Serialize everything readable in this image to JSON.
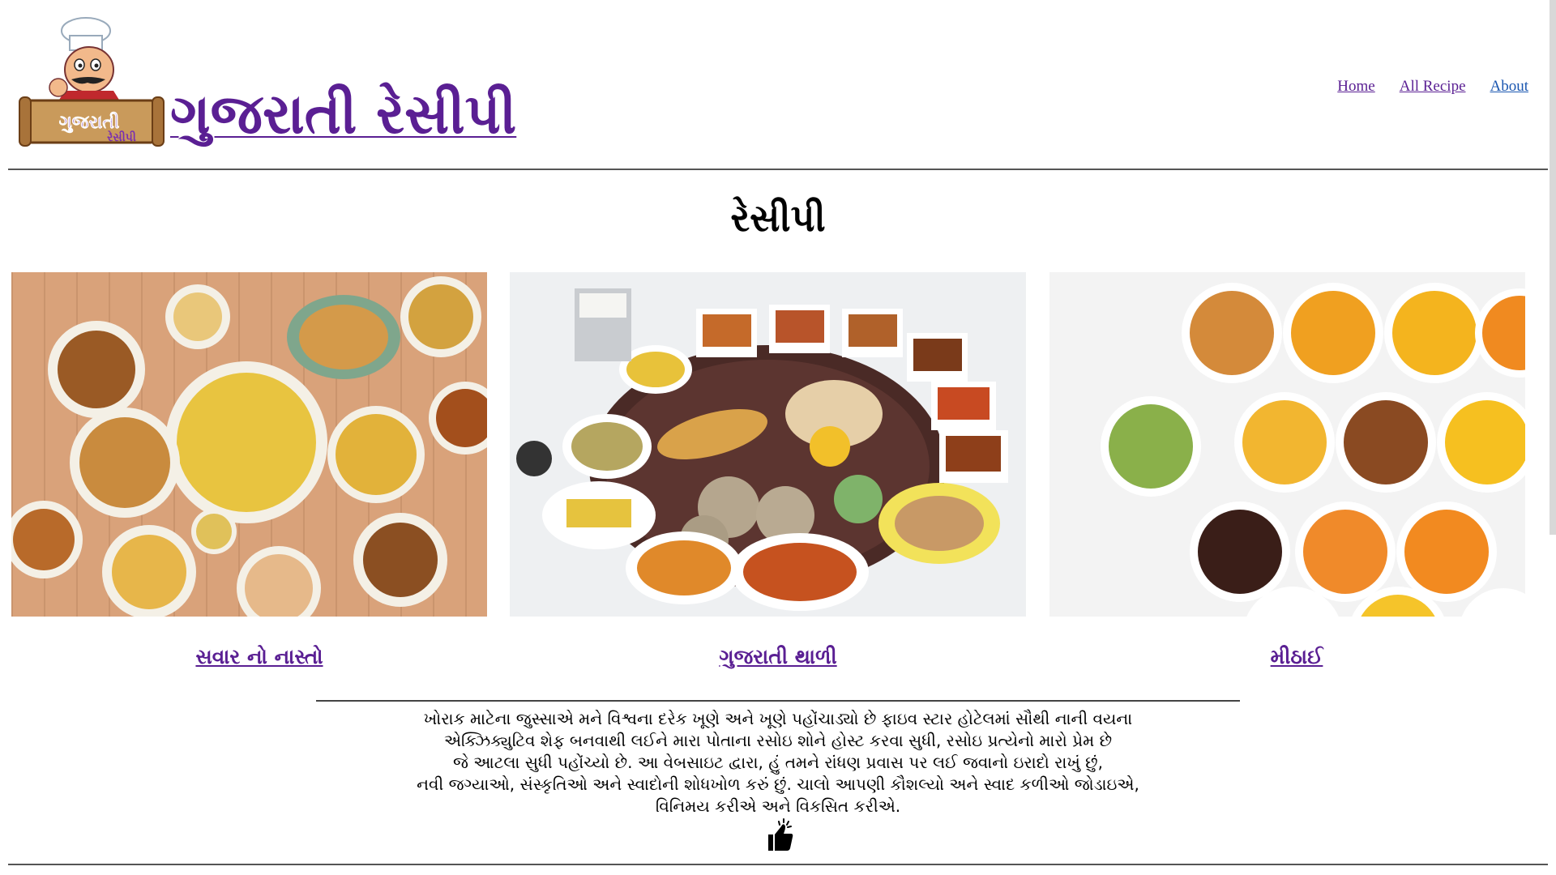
{
  "header": {
    "site_title": "ગુજરાતી રેસીપી",
    "logo_alt": "ગુજરાતી રેસીપી logo"
  },
  "nav": [
    {
      "label": "Home"
    },
    {
      "label": "All Recipe"
    },
    {
      "label": "About"
    }
  ],
  "main": {
    "section_title": "રેસીપી",
    "cards": [
      {
        "label": "સવાર નો નાસ્તો",
        "image": "snacks-platter"
      },
      {
        "label": "ગુજરાતી થાળી",
        "image": "gujarati-thali"
      },
      {
        "label": "મીઠાઈ",
        "image": "sweets-bowls"
      }
    ]
  },
  "about": {
    "lines": [
      "ખોરાક માટેના જુસ્સાએ મને વિશ્વના દરેક ખૂણે અને ખૂણે પહોંચાડ્યો છે ફાઇવ સ્ટાર હોટેલમાં સૌથી નાની વયના",
      "એક્ઝિક્યુટિવ શેફ બનવાથી લઈને મારા પોતાના રસોઇ શોને હોસ્ટ કરવા સુધી, રસોઇ પ્રત્યેનો મારો પ્રેમ છે",
      "જે આટલા સુધી પહોંચ્યો છે. આ વેબસાઇટ દ્વારા, હું તમને રાંધણ પ્રવાસ પર લઈ જવાનો ઇરાદો રાખું છું,",
      "નવી જગ્યાઓ, સંસ્કૃતિઓ અને સ્વાદોની શોધખોળ કરું છું. ચાલો આપણી કૌશલ્યો અને સ્વાદ કળીઓ જોડાઇએ,",
      "વિનિમય કરીએ અને વિકસિત કરીએ."
    ],
    "icon": "thumbs-up-icon"
  },
  "colors": {
    "brand": "#5a1f93",
    "link_visited": "#5a1f93",
    "link": "#1a56b0"
  }
}
